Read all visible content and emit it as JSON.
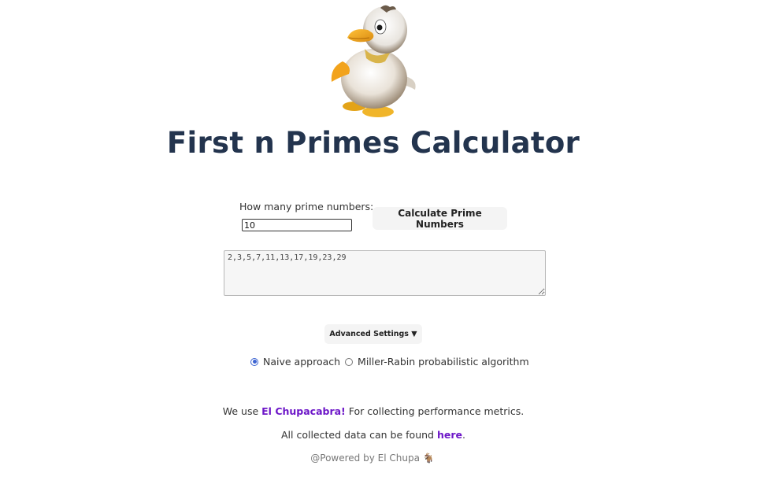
{
  "header": {
    "title": "First n Primes Calculator"
  },
  "form": {
    "count_label": "How many prime numbers:",
    "count_value": "10",
    "calculate_label": "Calculate Prime Numbers"
  },
  "result": {
    "output": "2,3,5,7,11,13,17,19,23,29"
  },
  "advanced": {
    "toggle_label": "Advanced Settings ▼",
    "options": [
      {
        "label": "Naive approach",
        "selected": true
      },
      {
        "label": "Miller-Rabin probabilistic algorithm",
        "selected": false
      }
    ]
  },
  "footer": {
    "metrics_prefix": "We use ",
    "metrics_link": "El Chupacabra!",
    "metrics_suffix": " For collecting performance metrics.",
    "data_prefix": "All collected data can be found ",
    "data_link": "here",
    "data_suffix": ".",
    "powered": "@Powered by El Chupa 🐐"
  },
  "colors": {
    "title": "#23344e",
    "link": "#6d17c8",
    "radio_accent": "#3b63d1"
  }
}
